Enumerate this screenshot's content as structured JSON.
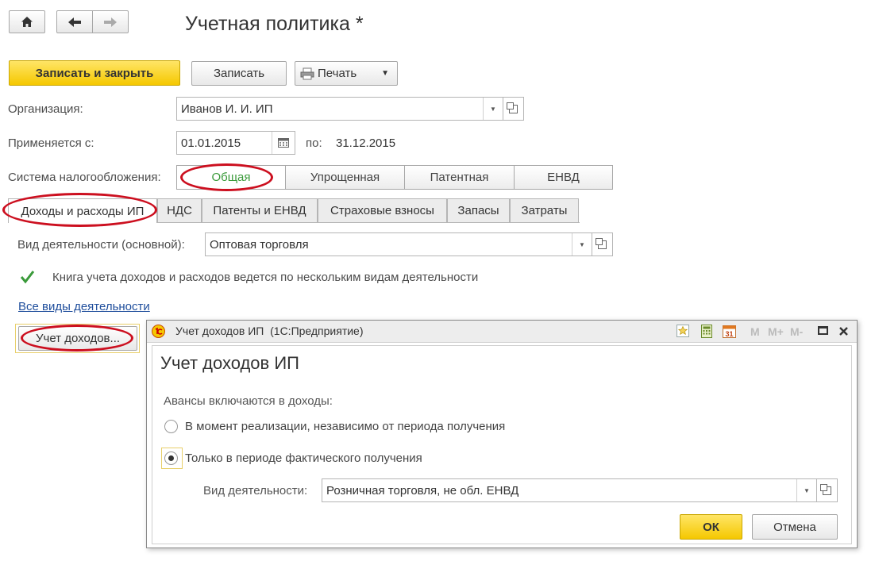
{
  "window": {
    "title": "Учетная политика *"
  },
  "nav": {
    "home_icon": "home-icon",
    "back_icon": "arrow-left-icon",
    "forward_icon": "arrow-right-icon"
  },
  "toolbar": {
    "save_close": "Записать и закрыть",
    "save": "Записать",
    "print": "Печать"
  },
  "form": {
    "org_label": "Организация:",
    "org_value": "Иванов И. И. ИП",
    "applies_label": "Применяется с:",
    "applies_from": "01.01.2015",
    "to_label": "по:",
    "applies_to": "31.12.2015",
    "tax_label": "Система налогообложения:",
    "tax_options": [
      "Общая",
      "Упрощенная",
      "Патентная",
      "ЕНВД"
    ],
    "tax_selected": "Общая"
  },
  "tabs": [
    "Доходы и расходы ИП",
    "НДС",
    "Патенты и ЕНВД",
    "Страховые взносы",
    "Запасы",
    "Затраты"
  ],
  "income_tab": {
    "activity_label": "Вид деятельности (основной):",
    "activity_value": "Оптовая торговля",
    "book_checkbox": "Книга учета доходов и расходов ведется по нескольким видам деятельности",
    "book_checked": true,
    "all_activities_link": "Все виды деятельности",
    "income_button": "Учет доходов..."
  },
  "dialog": {
    "window_title": "Учет доходов ИП  (1С:Предприятие)",
    "title": "Учет доходов ИП",
    "advances_label": "Авансы включаются в доходы:",
    "option1": "В момент реализации, независимо от периода получения",
    "option2": "Только в периоде фактического получения",
    "selected_option": 2,
    "activity_label": "Вид деятельности:",
    "activity_value": "Розничная торговля, не обл. ЕНВД",
    "ok": "ОК",
    "cancel": "Отмена",
    "titlebar_buttons": {
      "m": "M",
      "mplus": "M+",
      "mminus": "M-"
    }
  },
  "colors": {
    "accent_yellow": "#f5c800",
    "annotation_red": "#cc0f1f",
    "selected_green": "#3a9a3a",
    "link_blue": "#1f4e9c"
  }
}
